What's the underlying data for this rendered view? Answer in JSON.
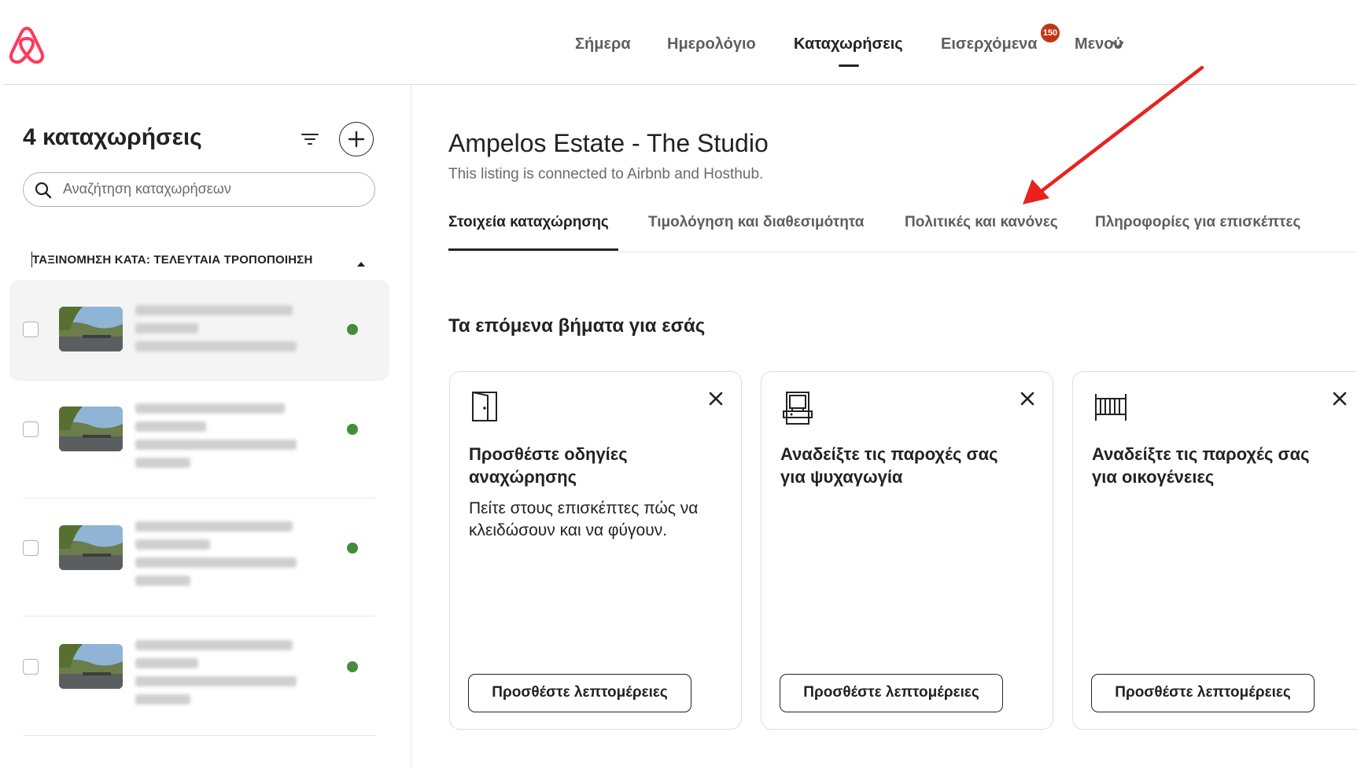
{
  "colors": {
    "brand": "#ff385c",
    "badge": "#c13515",
    "status_active": "#428e38",
    "arrow": "#e8231d"
  },
  "header": {
    "nav": [
      {
        "label": "Σήμερα",
        "active": false
      },
      {
        "label": "Ημερολόγιο",
        "active": false
      },
      {
        "label": "Καταχωρήσεις",
        "active": true
      },
      {
        "label": "Εισερχόμενα",
        "active": false
      },
      {
        "label": "Μενού",
        "active": false
      }
    ],
    "inbox_badge": "150",
    "menu_icon": "chevron-down-icon"
  },
  "sidebar": {
    "count_title": "4 καταχωρήσεις",
    "search_placeholder": "Αναζήτηση καταχωρήσεων",
    "sort_label": "ΤΑΞΙΝΟΜΗΣΗ ΚΑΤΑ: ΤΕΛΕΥΤΑΙΑ ΤΡΟΠΟΠΟΙΗΣΗ",
    "listings": [
      {
        "selected": true,
        "status": "active"
      },
      {
        "selected": false,
        "status": "active"
      },
      {
        "selected": false,
        "status": "active"
      },
      {
        "selected": false,
        "status": "active"
      }
    ]
  },
  "main": {
    "title": "Ampelos Estate - The Studio",
    "subtitle": "This listing is connected to Airbnb and Hosthub.",
    "tabs": [
      {
        "label": "Στοιχεία καταχώρησης",
        "active": true
      },
      {
        "label": "Τιμολόγηση και διαθεσιμότητα",
        "active": false
      },
      {
        "label": "Πολιτικές και κανόνες",
        "active": false
      },
      {
        "label": "Πληροφορίες για επισκέπτες",
        "active": false
      }
    ],
    "next_steps_heading": "Τα επόμενα βήματα για εσάς",
    "cards": [
      {
        "icon": "door-icon",
        "title": "Προσθέστε οδηγίες αναχώρησης",
        "description": "Πείτε στους επισκέπτες πώς να κλειδώσουν και να φύγουν.",
        "button": "Προσθέστε λεπτομέρειες"
      },
      {
        "icon": "arcade-icon",
        "title": "Αναδείξτε τις παροχές σας για ψυχαγωγία",
        "description": "",
        "button": "Προσθέστε λεπτομέρειες"
      },
      {
        "icon": "crib-icon",
        "title": "Αναδείξτε τις παροχές σας για οικογένειες",
        "description": "",
        "button": "Προσθέστε λεπτομέρειες"
      }
    ]
  }
}
